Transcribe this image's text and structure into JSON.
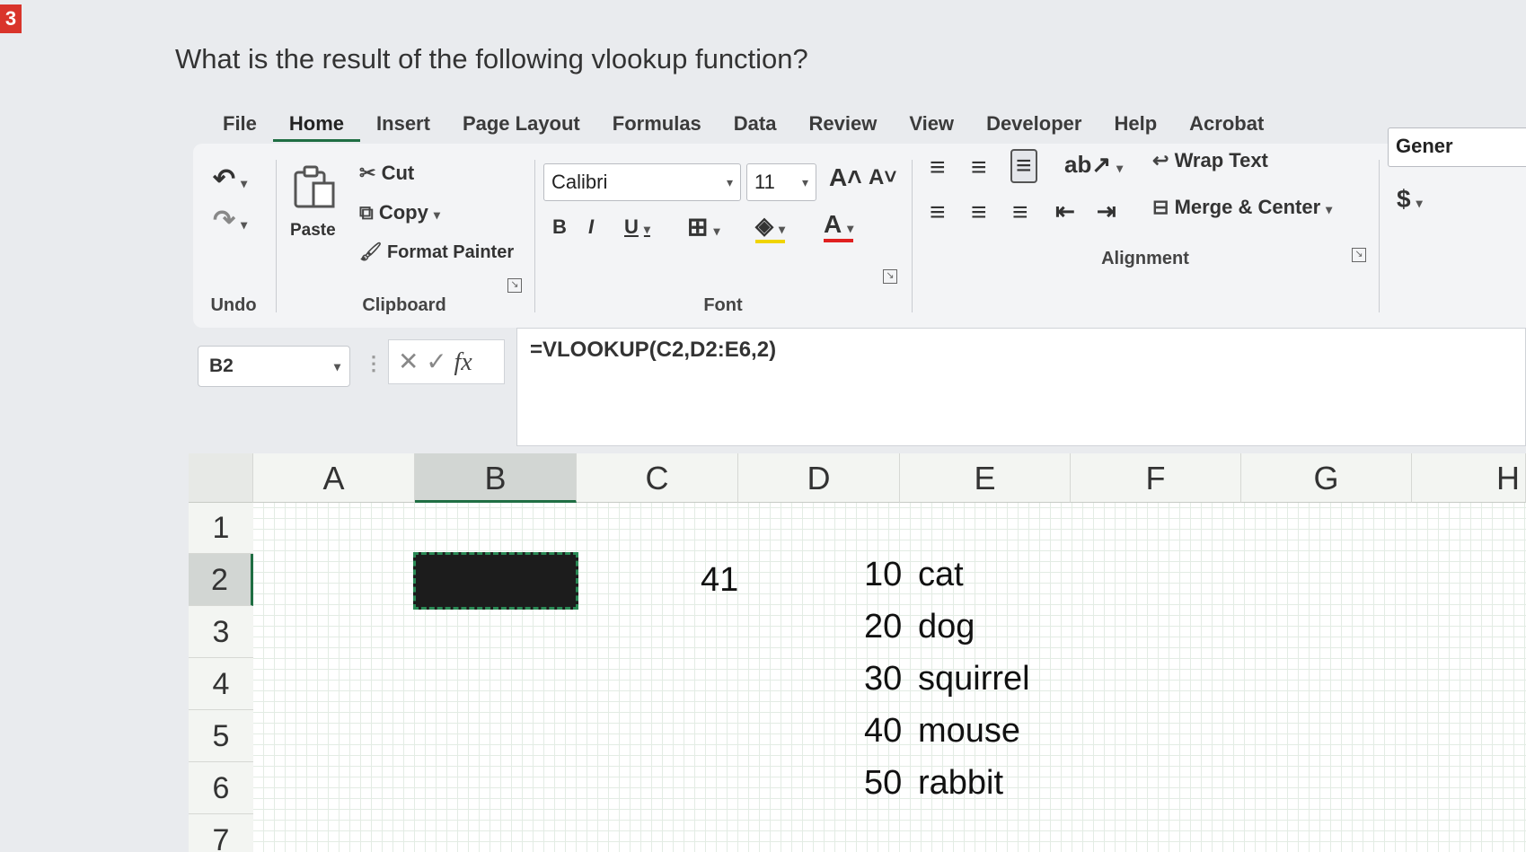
{
  "question_number": "3",
  "question": "What is the result of the following vlookup function?",
  "tabs": [
    "File",
    "Home",
    "Insert",
    "Page Layout",
    "Formulas",
    "Data",
    "Review",
    "View",
    "Developer",
    "Help",
    "Acrobat"
  ],
  "ribbon": {
    "undo_label": "Undo",
    "paste_label": "Paste",
    "cut_label": "Cut",
    "copy_label": "Copy",
    "format_painter_label": "Format Painter",
    "clipboard_label": "Clipboard",
    "font_name": "Calibri",
    "font_size": "11",
    "font_label": "Font",
    "bold": "B",
    "italic": "I",
    "underline": "U",
    "wrap_text_label": "Wrap Text",
    "merge_center_label": "Merge & Center",
    "alignment_label": "Alignment",
    "number_format": "Gener",
    "currency": "$"
  },
  "formula_bar": {
    "name_box": "B2",
    "formula": "=VLOOKUP(C2,D2:E6,2)"
  },
  "sheet": {
    "columns": [
      "A",
      "B",
      "C",
      "D",
      "E",
      "F",
      "G",
      "H"
    ],
    "rows": [
      "1",
      "2",
      "3",
      "4",
      "5",
      "6",
      "7"
    ],
    "c2": "41",
    "d_values": [
      "10",
      "20",
      "30",
      "40",
      "50"
    ],
    "e_values": [
      "cat",
      "dog",
      "squirrel",
      "mouse",
      "rabbit"
    ]
  }
}
